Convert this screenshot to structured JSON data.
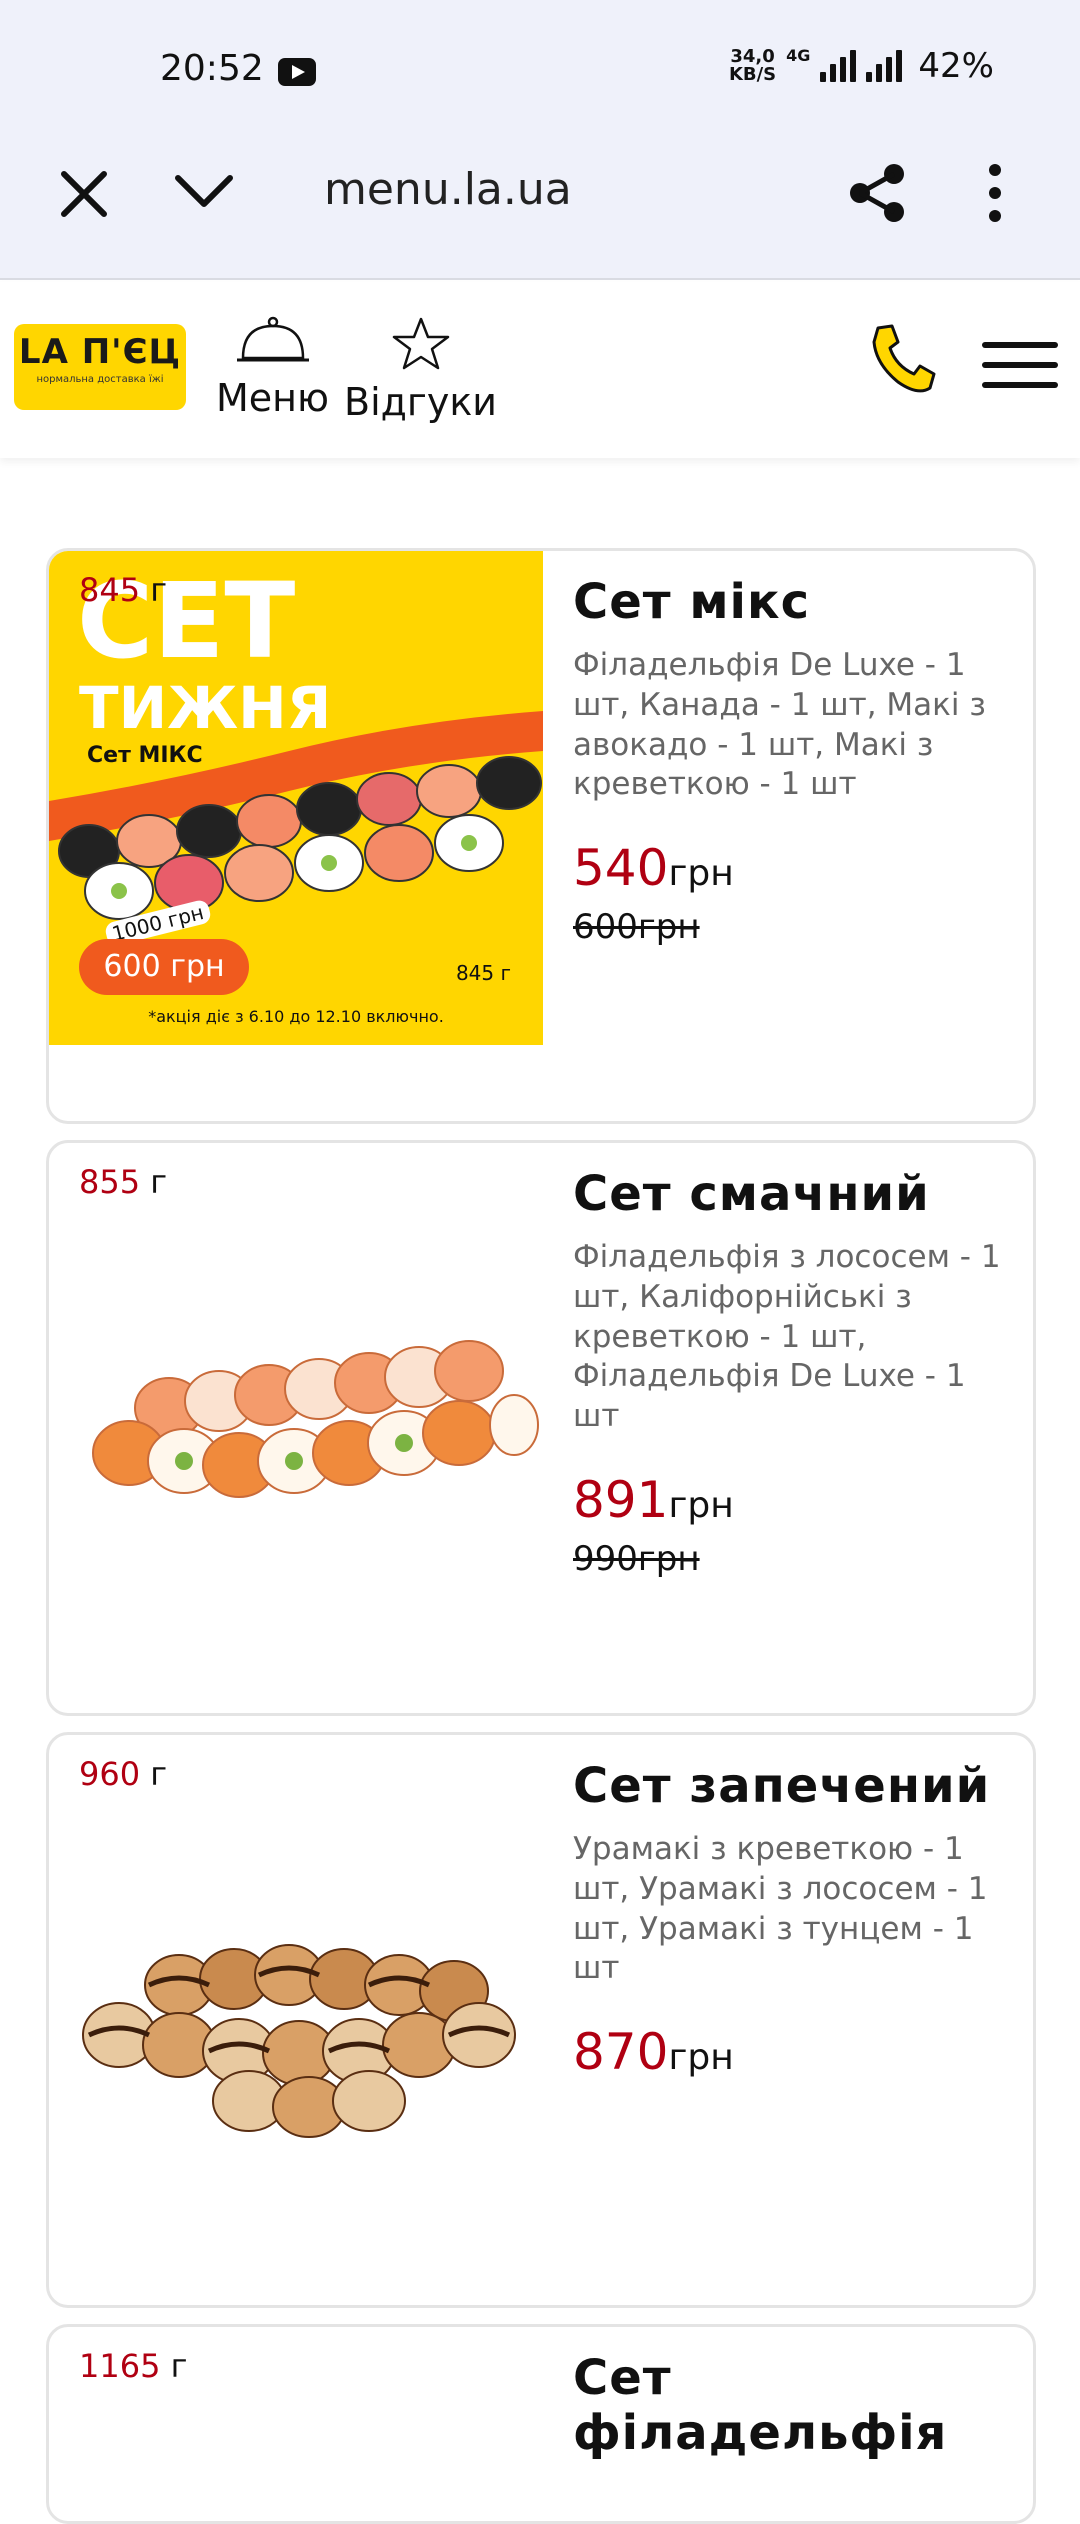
{
  "status_bar": {
    "time": "20:52",
    "net_speed_value": "34,0",
    "net_speed_unit": "KB/S",
    "network": "4G",
    "battery": "42%",
    "icons": [
      "youtube-icon",
      "signal-icon",
      "battery-icon"
    ]
  },
  "browser": {
    "url": "menu.la.ua"
  },
  "header": {
    "logo_title": "LA П'ЄЦ",
    "logo_subtitle": "нормальна доставка їжі",
    "nav": [
      {
        "label": "Меню",
        "icon": "cloche-icon"
      },
      {
        "label": "Відгуки",
        "icon": "star-icon"
      }
    ]
  },
  "products": [
    {
      "weight_value": "845",
      "weight_unit": "г",
      "title": "Сет мікс",
      "description": "Філадельфія De Luxe - 1 шт, Канада - 1 шт, Макі з авокадо - 1 шт, Макі з креветкою - 1 шт",
      "price": "540",
      "old_price": "600грн",
      "currency": "грн",
      "promo": {
        "title_line1": "СЕТ",
        "title_line2": "ТИЖНЯ",
        "set_name": "Сет МІКС",
        "old_price": "1000 грн",
        "price": "600 грн",
        "weight": "845 г",
        "note": "*акція діє з 6.10 до 12.10 включно."
      }
    },
    {
      "weight_value": "855",
      "weight_unit": "г",
      "title": "Сет смачний",
      "description": "Філадельфія з лососем - 1 шт, Каліфорнійські з креветкою - 1 шт, Філадельфія De Luxe - 1 шт",
      "price": "891",
      "old_price": "990грн",
      "currency": "грн"
    },
    {
      "weight_value": "960",
      "weight_unit": "г",
      "title": "Сет запечений",
      "description": "Урамакі з креветкою - 1 шт, Урамакі з лососем - 1 шт, Урамакі з тунцем - 1 шт",
      "price": "870",
      "currency": "грн"
    },
    {
      "weight_value": "1165",
      "weight_unit": "г",
      "title": "Сет філадельфія"
    }
  ],
  "colors": {
    "brand_yellow": "#ffd600",
    "price_red": "#b00012",
    "promo_orange": "#f05a1e",
    "chrome_bg": "#eff1fa"
  }
}
